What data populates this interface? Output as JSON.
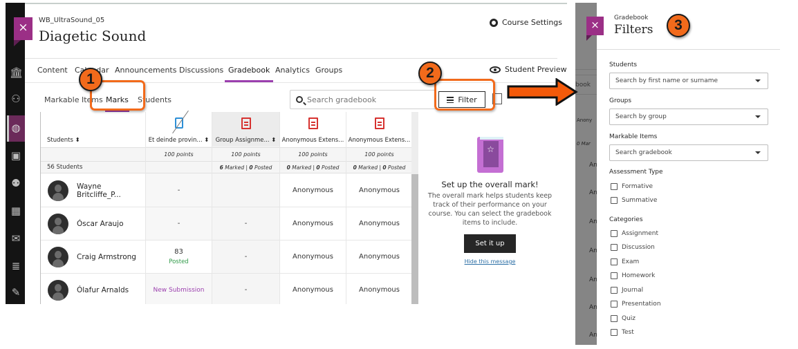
{
  "gradebook_view": {
    "course_code": "WB_UltraSound_05",
    "course_title": "Diagetic Sound",
    "course_settings_label": "Course Settings",
    "student_preview_label": "Student Preview",
    "nav_tabs": [
      "Content",
      "Calendar",
      "Announcements",
      "Discussions",
      "Gradebook",
      "Analytics",
      "Groups"
    ],
    "active_nav_tab": "Gradebook",
    "sub_tabs": [
      "Markable Items",
      "Marks",
      "Students"
    ],
    "active_sub_tab": "Marks",
    "search": {
      "placeholder": "Search gradebook",
      "value": ""
    },
    "filter_button_label": "Filter",
    "grid": {
      "student_column_header": "Students",
      "student_count": "56 Students",
      "columns": [
        {
          "title": "Et deinde provin...",
          "points": "100 points",
          "stats": ""
        },
        {
          "title": "Group Assignme...",
          "points": "100 points",
          "stats_marked": "6",
          "stats_posted": "0"
        },
        {
          "title": "Anonymous Extens...",
          "points": "100 points",
          "stats_marked": "0",
          "stats_posted": "0"
        },
        {
          "title": "Anonymous Extens...",
          "points": "100 points",
          "stats_marked": "0",
          "stats_posted": "0"
        }
      ],
      "stats_marked_word": "Marked",
      "stats_posted_word": "Posted",
      "rows": [
        {
          "student": "Wayne Britcliffe_P...",
          "cells": [
            {
              "value": "-"
            },
            {
              "value": ""
            },
            {
              "value": "Anonymous"
            },
            {
              "value": "Anonymous"
            }
          ]
        },
        {
          "student": "Óscar Araujo",
          "cells": [
            {
              "value": "-"
            },
            {
              "value": "-"
            },
            {
              "value": "Anonymous"
            },
            {
              "value": "Anonymous"
            }
          ]
        },
        {
          "student": "Craig Armstrong",
          "cells": [
            {
              "value": "83",
              "sub": "Posted"
            },
            {
              "value": "-"
            },
            {
              "value": "Anonymous"
            },
            {
              "value": "Anonymous"
            }
          ]
        },
        {
          "student": "Ólafur Arnalds",
          "cells": [
            {
              "value": "New Submission"
            },
            {
              "value": "-"
            },
            {
              "value": "Anonymous"
            },
            {
              "value": "Anonymous"
            }
          ]
        }
      ]
    },
    "overall_mark": {
      "title": "Set up the overall mark!",
      "body": "The overall mark helps students keep track of their performance on your course. You can select the gradebook items to include.",
      "button": "Set it up",
      "hide_link": "Hide this message"
    },
    "close_label": "×"
  },
  "callouts": [
    "1",
    "2",
    "3"
  ],
  "filters_panel": {
    "subtitle": "Gradebook",
    "title": "Filters",
    "close_label": "×",
    "students": {
      "label": "Students",
      "placeholder": "Search by first name or surname"
    },
    "groups": {
      "label": "Groups",
      "placeholder": "Search by group"
    },
    "markable_items": {
      "label": "Markable Items",
      "placeholder": "Search gradebook"
    },
    "assessment_type": {
      "label": "Assessment Type",
      "options": [
        "Formative",
        "Summative"
      ]
    },
    "categories": {
      "label": "Categories",
      "options": [
        "Assignment",
        "Discussion",
        "Exam",
        "Homework",
        "Journal",
        "Presentation",
        "Quiz",
        "Test"
      ]
    },
    "background_fragments": [
      "book",
      "Anony",
      "0 Mar",
      "An"
    ]
  },
  "colors": {
    "accent_purple": "#9b3fae",
    "close_magenta": "#9b2f86",
    "callout_orange": "#f26a1b",
    "posted_green": "#2f9a48",
    "overdue_red": "#d6312f"
  }
}
